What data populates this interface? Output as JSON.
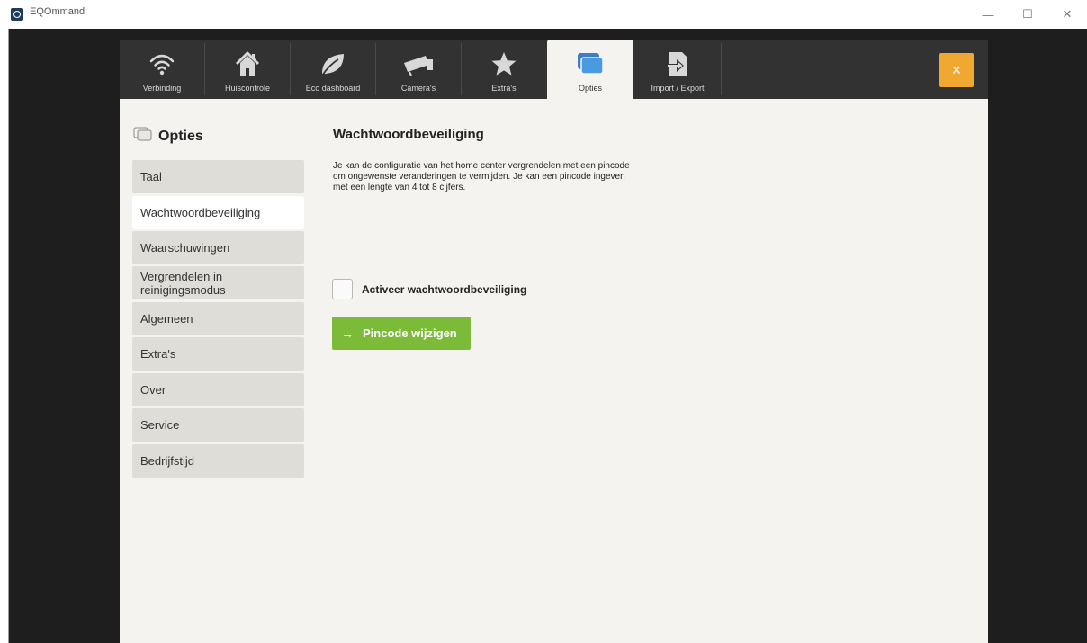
{
  "window": {
    "title": "EQOmmand",
    "controls": {
      "minimize": "—",
      "maximize": "☐",
      "close": "✕"
    }
  },
  "nav": {
    "items": [
      {
        "label": "Verbinding",
        "icon": "wifi-icon"
      },
      {
        "label": "Huiscontrole",
        "icon": "house-icon"
      },
      {
        "label": "Eco dashboard",
        "icon": "leaf-icon"
      },
      {
        "label": "Camera's",
        "icon": "camera-icon"
      },
      {
        "label": "Extra's",
        "icon": "star-icon"
      },
      {
        "label": "Opties",
        "icon": "options-icon",
        "active": true
      },
      {
        "label": "Import / Export",
        "icon": "import-export-icon"
      }
    ],
    "close_label": "×"
  },
  "sidebar": {
    "title": "Opties",
    "items": [
      {
        "label": "Taal"
      },
      {
        "label": "Wachtwoordbeveiliging",
        "active": true
      },
      {
        "label": "Waarschuwingen"
      },
      {
        "label": "Vergrendelen in reinigingsmodus"
      },
      {
        "label": "Algemeen"
      },
      {
        "label": "Extra's"
      },
      {
        "label": "Over"
      },
      {
        "label": "Service"
      },
      {
        "label": "Bedrijfstijd"
      }
    ]
  },
  "content": {
    "title": "Wachtwoordbeveiliging",
    "description": "Je kan de configuratie van het home center vergrendelen met een pincode om ongewenste veranderingen te vermijden. Je kan een pincode ingeven met een lengte van 4 tot 8 cijfers.",
    "checkbox_label": "Activeer wachtwoordbeveiliging",
    "checkbox_checked": false,
    "pin_button_label": "Pincode wijzigen"
  },
  "colors": {
    "accent_orange": "#f0a830",
    "accent_green": "#7bbb38",
    "active_tab_blue": "#4a8fd6",
    "nav_bg": "#323232",
    "panel_bg": "#f4f3ef"
  }
}
